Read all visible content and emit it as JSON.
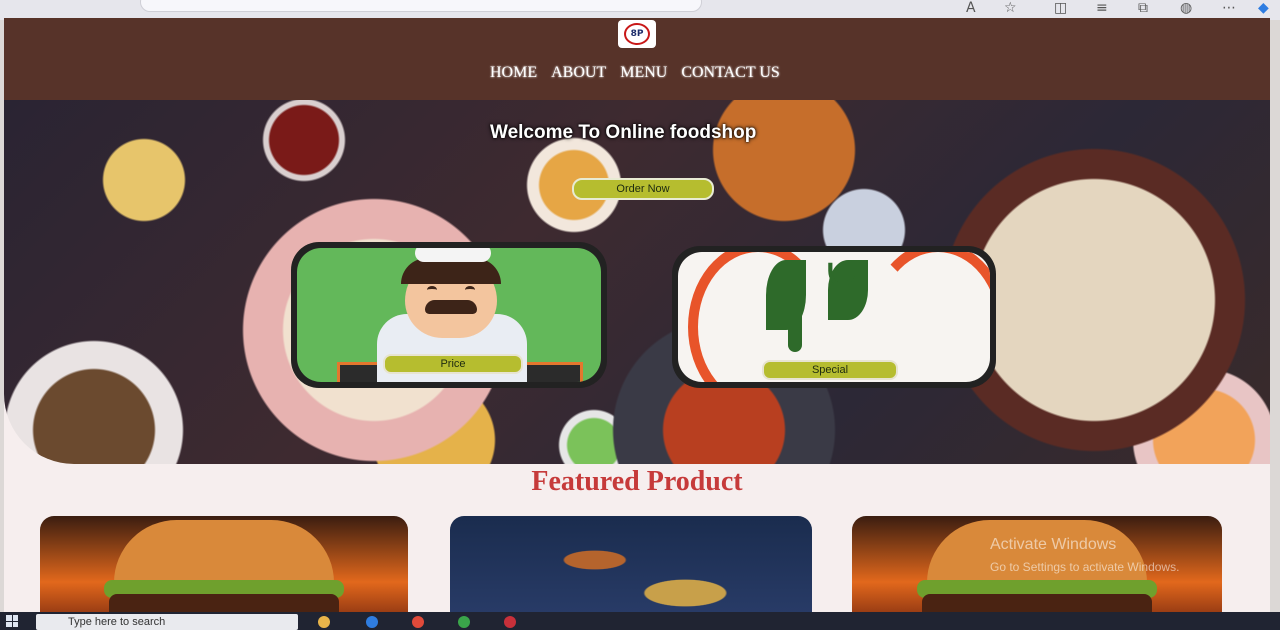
{
  "browser": {
    "icons": [
      "read-aloud-icon",
      "favorite-star-icon",
      "split-screen-icon",
      "favorites-icon",
      "collections-icon",
      "extensions-icon",
      "more-icon",
      "copilot-icon"
    ]
  },
  "site": {
    "logo_text": "8P",
    "nav": [
      "HOME",
      "ABOUT",
      "MENU",
      "CONTACT US"
    ]
  },
  "hero": {
    "title": "Welcome To Online foodshop",
    "order_button": "Order Now",
    "cards": [
      {
        "label": "Price"
      },
      {
        "label": "Special"
      }
    ]
  },
  "featured": {
    "heading": "Featured Product",
    "products": [
      {
        "image": "burger-image"
      },
      {
        "image": "meat-dish-image"
      },
      {
        "image": "burger-image"
      }
    ]
  },
  "watermark": {
    "line1": "Activate Windows",
    "line2": "Go to Settings to activate Windows."
  },
  "taskbar": {
    "search_placeholder": "Type here to search"
  },
  "colors": {
    "header": "#573329",
    "accent_button": "#b6bd2f",
    "heading_red": "#c63a3a"
  }
}
